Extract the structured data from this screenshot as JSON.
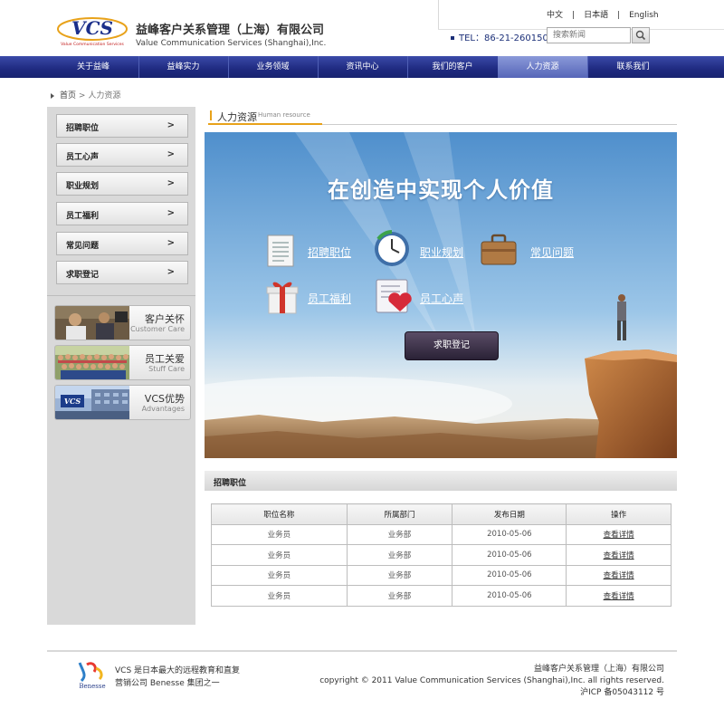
{
  "header": {
    "logo_text": "VCS",
    "logo_sub": "Value Communication Services",
    "company_cn": "益峰客户关系管理（上海）有限公司",
    "company_en": "Value Communication Services (Shanghai),Inc.",
    "tel": "TEL：86-21-26015000",
    "langs": [
      "中文",
      "日本語",
      "English"
    ],
    "search_placeholder": "搜索新闻"
  },
  "nav": {
    "items": [
      "关于益峰",
      "益峰实力",
      "业务领域",
      "资讯中心",
      "我们的客户",
      "人力资源",
      "联系我们"
    ],
    "active_index": 5
  },
  "breadcrumb": {
    "home": "首页",
    "sep": ">",
    "current": "人力资源"
  },
  "sidebar": {
    "menu": [
      "招聘职位",
      "员工心声",
      "职业规划",
      "员工福利",
      "常见问题",
      "求职登记"
    ],
    "arrow": ">",
    "cards": [
      {
        "title": "客户关怀",
        "sub": "Customer Care"
      },
      {
        "title": "员工关爱",
        "sub": "Stuff Care"
      },
      {
        "title": "VCS优势",
        "sub": "Advantages"
      }
    ]
  },
  "section": {
    "title": "人力资源",
    "subtitle": "Human resource"
  },
  "banner": {
    "headline": "在创造中实现个人价值",
    "links": [
      "招聘职位",
      "职业规划",
      "常见问题",
      "员工福利",
      "员工心声"
    ],
    "button": "求职登记"
  },
  "jobs": {
    "header": "招聘职位",
    "columns": [
      "职位名称",
      "所属部门",
      "发布日期",
      "操作"
    ],
    "rows": [
      [
        "业务员",
        "业务部",
        "2010-05-06",
        "查看详情"
      ],
      [
        "业务员",
        "业务部",
        "2010-05-06",
        "查看详情"
      ],
      [
        "业务员",
        "业务部",
        "2010-05-06",
        "查看详情"
      ],
      [
        "业务员",
        "业务部",
        "2010-05-06",
        "查看详情"
      ]
    ]
  },
  "footer": {
    "left_line1": "VCS 是日本最大的远程教育和直复",
    "left_line2": "营销公司 Benesse 集团之一",
    "right_line1": "益峰客户关系管理（上海）有限公司",
    "right_line2": "copyright © 2011 Value Communication Services (Shanghai),Inc. all rights reserved.",
    "right_line3": "沪ICP 备05043112 号",
    "logo_text": "Benesse"
  },
  "colors": {
    "nav_blue": "#1f2a80",
    "accent_orange": "#e8a21a",
    "sky_blue": "#5e9fd6"
  }
}
